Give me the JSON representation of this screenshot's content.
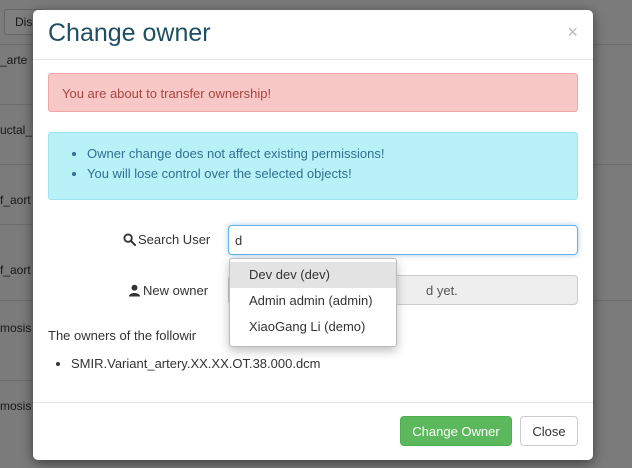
{
  "background": {
    "button_label": "Dis",
    "rows": [
      "_arte",
      "uctal_",
      "f_aort",
      "f_aort",
      "mosis",
      "mosis"
    ]
  },
  "modal": {
    "title": "Change owner",
    "close_symbol": "×",
    "danger_alert": "You are about to transfer ownership!",
    "info_items": [
      "Owner change does not affect existing permissions!",
      "You will lose control over the selected objects!"
    ],
    "search_label": "Search User",
    "search_value": "d",
    "new_owner_label": "New owner",
    "new_owner_placeholder": "d yet.",
    "suggestions": [
      "Dev dev (dev)",
      "Admin admin (admin)",
      "XiaoGang Li (demo)"
    ],
    "objects_text": "The owners of the following obj",
    "objects": [
      "SMIR.Variant_artery.XX.XX.OT.38.000.dcm"
    ],
    "change_owner_button": "Change Owner",
    "close_button": "Close"
  },
  "colors": {
    "title": "#1f4f63",
    "danger_bg": "#f8c8c7",
    "info_bg": "#b9f1f8",
    "primary_green": "#5cb85c"
  },
  "icons": {
    "search": "search-icon",
    "user": "user-icon"
  }
}
